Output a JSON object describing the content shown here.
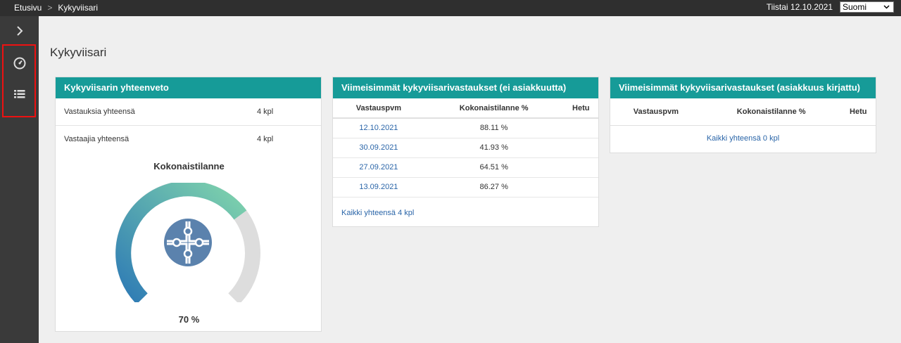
{
  "topbar": {
    "breadcrumbs": [
      "Etusivu",
      "Kykyviisari"
    ],
    "separator": ">",
    "date": "Tiistai 12.10.2021",
    "language": "Suomi"
  },
  "page": {
    "title": "Kykyviisari"
  },
  "summary": {
    "title": "Kykyviisarin yhteenveto",
    "rows": [
      {
        "label": "Vastauksia yhteensä",
        "value": "4 kpl"
      },
      {
        "label": "Vastaajia yhteensä",
        "value": "4 kpl"
      }
    ],
    "gauge_title": "Kokonaistilanne",
    "gauge_value": "70 %",
    "gauge_fraction": 0.7,
    "colors": {
      "gauge_start": "#2e7bb5",
      "gauge_end": "#7fd3ac",
      "gauge_bg": "#dddddd",
      "icon": "#5b82ad"
    }
  },
  "recent_no_client": {
    "title": "Viimeisimmät kykyviisarivastaukset (ei asiakkuutta)",
    "columns": [
      "Vastauspvm",
      "Kokonaistilanne %",
      "Hetu"
    ],
    "rows": [
      {
        "date": "12.10.2021",
        "pct": "88.11 %",
        "hetu": ""
      },
      {
        "date": "30.09.2021",
        "pct": "41.93 %",
        "hetu": ""
      },
      {
        "date": "27.09.2021",
        "pct": "64.51 %",
        "hetu": ""
      },
      {
        "date": "13.09.2021",
        "pct": "86.27 %",
        "hetu": ""
      }
    ],
    "total": "Kaikki yhteensä 4 kpl"
  },
  "recent_client": {
    "title": "Viimeisimmät kykyviisarivastaukset (asiakkuus kirjattu)",
    "columns": [
      "Vastauspvm",
      "Kokonaistilanne %",
      "Hetu"
    ],
    "total": "Kaikki yhteensä 0 kpl"
  },
  "theme": {
    "accent": "#169b98",
    "topbar": "#2f2f2f",
    "sidebar": "#3a3a3a",
    "link": "#2a65a8"
  }
}
